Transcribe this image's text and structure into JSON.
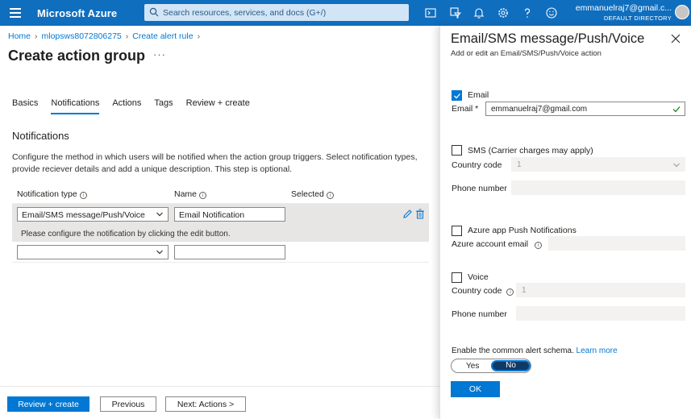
{
  "topbar": {
    "brand": "Microsoft Azure",
    "search_placeholder": "Search resources, services, and docs (G+/)",
    "user_email": "emmanuelraj7@gmail.c...",
    "user_directory": "DEFAULT DIRECTORY",
    "icons": [
      "cloud-shell-icon",
      "directory-filter-icon",
      "notifications-icon",
      "settings-icon",
      "help-icon",
      "feedback-icon"
    ]
  },
  "breadcrumb": {
    "items": [
      "Home",
      "mlopsws8072806275",
      "Create alert rule"
    ]
  },
  "page": {
    "title": "Create action group",
    "more": "···"
  },
  "tabs": [
    "Basics",
    "Notifications",
    "Actions",
    "Tags",
    "Review + create"
  ],
  "notifications": {
    "title": "Notifications",
    "description": "Configure the method in which users will be notified when the action group triggers. Select notification types, provide reciever details and add a unique description. This step is optional.",
    "headers": {
      "type": "Notification type",
      "name": "Name",
      "selected": "Selected"
    },
    "rows": [
      {
        "type": "Email/SMS message/Push/Voice",
        "name": "Email Notification",
        "message": "Please configure the notification by clicking the edit button."
      }
    ]
  },
  "footer": {
    "review_create": "Review + create",
    "previous": "Previous",
    "next": "Next: Actions >"
  },
  "panel": {
    "title": "Email/SMS message/Push/Voice",
    "subtitle": "Add or edit an Email/SMS/Push/Voice action",
    "email": {
      "checkbox_label": "Email",
      "checked": true,
      "field_label": "Email *",
      "value": "emmanuelraj7@gmail.com"
    },
    "sms": {
      "checkbox_label": "SMS (Carrier charges may apply)",
      "checked": false,
      "country_code_label": "Country code",
      "country_code_value": "1",
      "phone_label": "Phone number"
    },
    "push": {
      "checkbox_label": "Azure app Push Notifications",
      "checked": false,
      "account_label": "Azure account email"
    },
    "voice": {
      "checkbox_label": "Voice",
      "checked": false,
      "country_code_label": "Country code",
      "country_code_value": "1",
      "phone_label": "Phone number"
    },
    "schema": {
      "label": "Enable the common alert schema.",
      "link": "Learn more",
      "yes": "Yes",
      "no": "No",
      "selected": "No"
    },
    "ok": "OK"
  },
  "colors": {
    "topbar": "#106ebe",
    "accent": "#0078d4",
    "row_highlight": "#e8e6e4"
  }
}
